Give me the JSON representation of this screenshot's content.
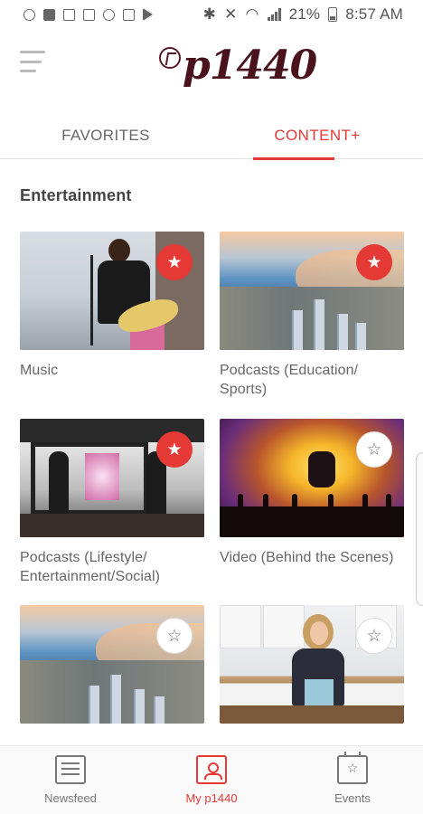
{
  "status_bar": {
    "battery": "21%",
    "time": "8:57 AM",
    "left_icons": [
      "notification-icon",
      "facebook-icon",
      "checklist-icon",
      "image-icon",
      "mic-icon",
      "document-icon",
      "play-store-icon"
    ],
    "right_icons": [
      "bluetooth-icon",
      "mute-icon",
      "wifi-icon",
      "signal-icon",
      "battery-icon"
    ]
  },
  "header": {
    "logo_text": "p1440",
    "menu_icon": "hamburger-menu-icon"
  },
  "tabs": [
    {
      "label": "FAVORITES",
      "active": false
    },
    {
      "label": "CONTENT+",
      "active": true
    }
  ],
  "section": {
    "title": "Entertainment"
  },
  "cards": [
    {
      "label": "Music",
      "favorited": true,
      "scene": "music"
    },
    {
      "label": "Podcasts (Education/ Sports)",
      "favorited": true,
      "scene": "city"
    },
    {
      "label": "Podcasts (Lifestyle/ Entertainment/Social)",
      "favorited": true,
      "scene": "stage"
    },
    {
      "label": "Video (Behind the Scenes)",
      "favorited": false,
      "scene": "concert"
    },
    {
      "label": "",
      "favorited": false,
      "scene": "city"
    },
    {
      "label": "",
      "favorited": false,
      "scene": "kitchen"
    }
  ],
  "icons": {
    "star_filled": "★",
    "star_outline": "☆"
  },
  "bottom_nav": [
    {
      "label": "Newsfeed",
      "icon": "newsfeed-icon",
      "active": false
    },
    {
      "label": "My p1440",
      "icon": "profile-icon",
      "active": true
    },
    {
      "label": "Events",
      "icon": "events-icon",
      "active": false
    }
  ],
  "colors": {
    "accent": "#e53935",
    "brand": "#4a121d",
    "text_muted": "#666666"
  }
}
